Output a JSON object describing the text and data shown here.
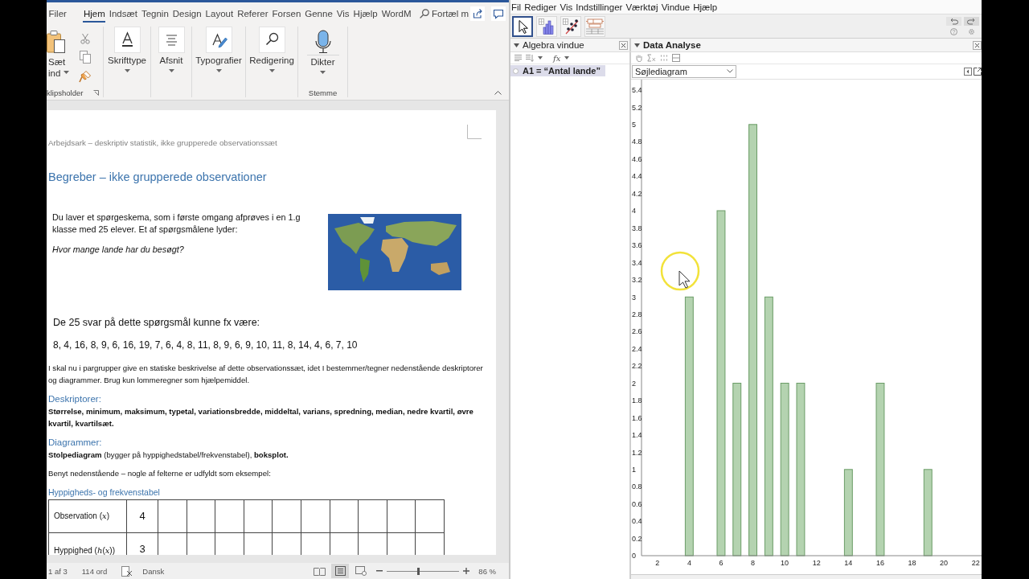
{
  "word": {
    "tabs": [
      {
        "label": "Filer",
        "selected": false
      },
      {
        "label": "Hjem",
        "selected": true
      },
      {
        "label": "Indsæt",
        "selected": false
      },
      {
        "label": "Tegnin",
        "selected": false
      },
      {
        "label": "Design",
        "selected": false
      },
      {
        "label": "Layout",
        "selected": false
      },
      {
        "label": "Referer",
        "selected": false
      },
      {
        "label": "Forsen",
        "selected": false
      },
      {
        "label": "Genne",
        "selected": false
      },
      {
        "label": "Vis",
        "selected": false
      },
      {
        "label": "Hjælp",
        "selected": false
      },
      {
        "label": "WordM",
        "selected": false
      }
    ],
    "search": {
      "placeholder": "Fortæl m"
    },
    "ribbon": [
      {
        "kind": "clipboard",
        "lines": [
          "Sæt",
          "ind"
        ],
        "group_label": "klipsholder"
      },
      {
        "kind": "font",
        "label": "Skrifttype"
      },
      {
        "kind": "paragraph",
        "label": "Afsnit"
      },
      {
        "kind": "styles",
        "label": "Typografier"
      },
      {
        "kind": "editing",
        "label": "Redigering"
      },
      {
        "kind": "dictate",
        "label": "Dikter",
        "group_label": "Stemme"
      }
    ],
    "document": {
      "header": "Arbejdsark – deskriptiv statistik, ikke grupperede observationssæt",
      "title": "Begreber – ikke grupperede observationer",
      "intro": "Du laver et spørgeskema, som i første omgang afprøves i en 1.g klasse med 25 elever. Et af spørgsmålene lyder:",
      "question": "Hvor mange lande har du besøgt?",
      "answers_intro": "De 25 svar på dette spørgsmål kunne fx være:",
      "answers": "8, 4, 16, 8, 9, 6, 16, 19, 7, 6, 4, 8, 11, 8, 9, 6, 9, 10, 11, 8, 14, 4, 6, 7, 10",
      "task": "I skal nu i pargrupper give en statiske beskrivelse af dette observationssæt, idet I bestemmer/tegner nedenstående deskriptorer og diagrammer. Brug kun lommeregner som hjælpemiddel.",
      "descriptors": {
        "heading": "Deskriptorer:",
        "text": "Størrelse, minimum, maksimum, typetal, variationsbredde, middeltal, varians, spredning, median, nedre kvartil, øvre kvartil, kvartilsæt."
      },
      "diagrams": {
        "heading": "Diagrammer:",
        "text": "**Stolpediagram** (bygger på hyppighedstabel/frekvenstabel), **boksplot.**"
      },
      "instruction": "Benyt nedenstående – nogle af felterne er udfyldt som eksempel:",
      "table_title": "Hyppigheds- og frekvenstabel",
      "table_rows": [
        {
          "label": "Observation (*x*)",
          "value": "4"
        },
        {
          "label": "Hyppighed (*h*(*x*))",
          "value": "3"
        }
      ]
    },
    "status_bar": {
      "page": "1 af 3",
      "words": "114 ord",
      "language": "Dansk",
      "views": [
        {
          "kind": "read",
          "selected": false
        },
        {
          "kind": "print",
          "selected": true
        },
        {
          "kind": "web",
          "selected": false
        }
      ],
      "zoom_slider": {
        "level": 0.44
      },
      "zoom": "86 %"
    }
  },
  "geogebra": {
    "menu": [
      "Fil",
      "Rediger",
      "Vis",
      "Indstillinger",
      "Værktøj",
      "Vindue",
      "Hjælp"
    ],
    "tools": [
      {
        "kind": "move",
        "selected": true
      },
      {
        "kind": "bar",
        "selected": false
      },
      {
        "kind": "scatter",
        "selected": false
      },
      {
        "kind": "table",
        "selected": false
      }
    ],
    "algebra": {
      "title": "Algebra vindue",
      "input_label": "fx",
      "items": [
        {
          "text": "A1 = “Antal lande”",
          "selected": true
        }
      ]
    },
    "data_analysis": {
      "title": "Data Analyse",
      "chart_select": {
        "value": "Søjlediagram"
      },
      "chart_data": [
        {
          "type": "bar",
          "x": [
            4,
            6,
            7,
            8,
            9,
            10,
            11,
            14,
            16,
            19
          ],
          "values": [
            3,
            4,
            2,
            5,
            3,
            2,
            2,
            1,
            2,
            1
          ],
          "color": "#b4d3b0",
          "xlim": [
            1,
            22.37
          ],
          "ylim": [
            0,
            5.52
          ],
          "xticks": [
            2,
            4,
            6,
            8,
            10,
            12,
            14,
            16,
            18,
            20,
            22
          ],
          "yticks": [
            0,
            0.2,
            0.4,
            0.6,
            0.8,
            1,
            1.2,
            1.4,
            1.6,
            1.8,
            2,
            2.2,
            2.4,
            2.6,
            2.8,
            3,
            3.2,
            3.4,
            3.6,
            3.8,
            4,
            4.2,
            4.4,
            4.6,
            4.8,
            5,
            5.2,
            5.4
          ]
        }
      ]
    }
  }
}
